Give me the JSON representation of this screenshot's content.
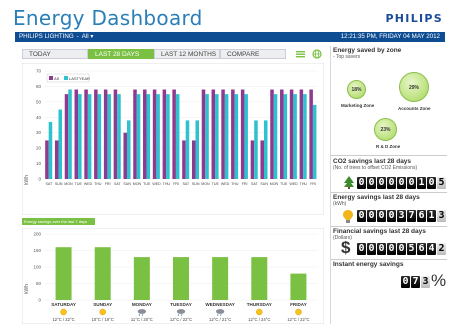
{
  "header": {
    "title": "Energy Dashboard",
    "brand": "PHILIPS"
  },
  "topbar": {
    "site": "PHILIPS LIGHTING",
    "separator": "-",
    "filter": "All ▾",
    "datetime": "12:21:35 PM, FRIDAY 04 MAY 2012"
  },
  "tabs": [
    {
      "label": "TODAY",
      "active": false
    },
    {
      "label": "LAST 28 DAYS",
      "active": true
    },
    {
      "label": "LAST 12 MONTHS",
      "active": false
    },
    {
      "label": "COMPARE",
      "active": false
    }
  ],
  "tab_icons": [
    "menu-lines-icon",
    "globe-icon"
  ],
  "colors": {
    "blue": "#2a7fb8",
    "topbar": "#0f4d93",
    "green": "#7ac143",
    "purple": "#8e3a8e",
    "cyan": "#2ec1cf",
    "brand": "#1a4c9c"
  },
  "chart_data": [
    {
      "type": "bar",
      "ylabel": "kWh",
      "ylim": [
        0,
        70
      ],
      "yticks": [
        0,
        10,
        20,
        30,
        40,
        50,
        60,
        70
      ],
      "legend": [
        "AS",
        "LASTYEAR"
      ],
      "legend_position": "top-left",
      "categories": [
        "SAT",
        "SUN",
        "MON",
        "TUE",
        "WED",
        "THU",
        "FRI",
        "SAT",
        "SUN",
        "MON",
        "TUE",
        "WED",
        "THU",
        "FRI",
        "SAT",
        "SUN",
        "MON",
        "TUE",
        "WED",
        "THU",
        "FRI",
        "SAT",
        "SUN",
        "MON",
        "TUE",
        "WED",
        "THU",
        "FRI"
      ],
      "series": [
        {
          "name": "AS",
          "values": [
            25,
            25,
            55,
            58,
            58,
            58,
            58,
            58,
            30,
            58,
            58,
            58,
            58,
            58,
            25,
            25,
            58,
            58,
            58,
            58,
            58,
            25,
            25,
            58,
            58,
            58,
            58,
            58
          ]
        },
        {
          "name": "LASTYEAR",
          "values": [
            37,
            45,
            58,
            55,
            55,
            55,
            55,
            55,
            38,
            55,
            55,
            55,
            55,
            55,
            38,
            38,
            55,
            55,
            55,
            55,
            55,
            38,
            38,
            55,
            55,
            55,
            55,
            48
          ]
        }
      ]
    },
    {
      "type": "bar",
      "title": "Energy savings over the last 7 days",
      "ylabel": "kWh",
      "ylim": [
        0,
        200
      ],
      "yticks": [
        0,
        50,
        100,
        150,
        200
      ],
      "categories": [
        "SATURDAY",
        "SUNDAY",
        "MONDAY",
        "TUESDAY",
        "WEDNESDAY",
        "THURSDAY",
        "FRIDAY"
      ],
      "values": [
        160,
        160,
        130,
        130,
        130,
        130,
        80
      ],
      "weather": [
        {
          "icon": "sun-icon",
          "temp": "12°C / 22°C"
        },
        {
          "icon": "sun-icon",
          "temp": "10°C / 19°C"
        },
        {
          "icon": "rain-cloud-icon",
          "temp": "11°C / 20°C"
        },
        {
          "icon": "rain-cloud-icon",
          "temp": "12°C / 22°C"
        },
        {
          "icon": "rain-cloud-icon",
          "temp": "12°C / 21°C"
        },
        {
          "icon": "sun-icon",
          "temp": "12°C / 24°C"
        },
        {
          "icon": "sun-icon",
          "temp": "12°C / 22°C"
        }
      ]
    }
  ],
  "zones": {
    "title": "Energy saved by zone",
    "subtitle": "- Top savers",
    "items": [
      {
        "pct": "18%",
        "label": "Marketing Zone"
      },
      {
        "pct": "29%",
        "label": "Accounts Zone"
      },
      {
        "pct": "23%",
        "label": "R & D Zone"
      }
    ]
  },
  "co2": {
    "title": "CO2 savings last 28 days",
    "subtitle": "(No. of trees to offset CO2 Emissions)",
    "digits": [
      "0",
      "0",
      "0",
      "0",
      "0",
      "0",
      "1",
      "0",
      "5"
    ],
    "icon": "tree-icon"
  },
  "energy": {
    "title": "Energy savings last 28 days",
    "subtitle": "(kWh)",
    "digits": [
      "0",
      "0",
      "0",
      "0",
      "3",
      "7",
      "6",
      "1",
      "3"
    ],
    "icon": "bulb-icon"
  },
  "financial": {
    "title": "Financial savings last 28 days",
    "subtitle": "(Dollars)",
    "symbol": "$",
    "digits": [
      "0",
      "0",
      "0",
      "0",
      "0",
      "5",
      "6",
      "4",
      "2"
    ]
  },
  "instant": {
    "title": "Instant energy savings",
    "digits": [
      "0",
      "7",
      "3"
    ],
    "unit": "%"
  }
}
